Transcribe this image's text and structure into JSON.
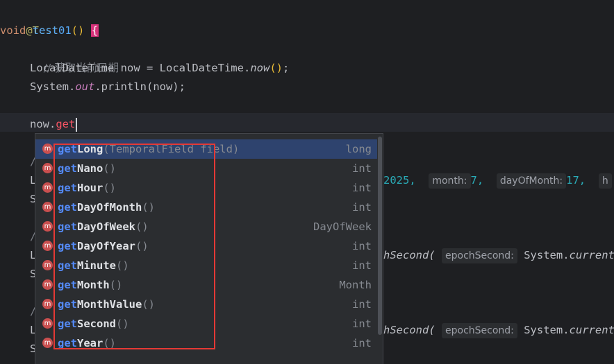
{
  "code": {
    "annotation": "@Test",
    "kw_void": "void",
    "method_name": "test01",
    "method_parens": "()",
    "open_brace": "{",
    "comment1": "// 获取当前日期",
    "l4_type": "LocalDateTime",
    "l4_var": " now = ",
    "l4_cls": "LocalDateTime.",
    "l4_call": "now",
    "l4_parens": "()",
    "l4_end": ";",
    "l5_sys": "System.",
    "l5_out": "out",
    "l5_rest": ".println(now);",
    "l7_prefix": "now.",
    "l7_typed": "get",
    "behind_year_val": "2025,",
    "hint_month": "month:",
    "month_val": "7,",
    "hint_day": "dayOfMonth:",
    "day_val": "17,",
    "hint_h": "h",
    "behind_epoch1": "hSecond(",
    "hint_epoch1": "epochSecond:",
    "sys_current1": "System.",
    "current1": "current",
    "behind_epoch2": "hSecond(",
    "hint_epoch2": "epochSecond:",
    "sys_current2": "System.",
    "current2": "current"
  },
  "completion": {
    "icon_letter": "m",
    "typed": "get",
    "items": [
      {
        "rest": "Long",
        "params": "(TemporalField field)",
        "type": "long"
      },
      {
        "rest": "Nano",
        "params": "()",
        "type": "int"
      },
      {
        "rest": "Hour",
        "params": "()",
        "type": "int"
      },
      {
        "rest": "DayOfMonth",
        "params": "()",
        "type": "int"
      },
      {
        "rest": "DayOfWeek",
        "params": "()",
        "type": "DayOfWeek"
      },
      {
        "rest": "DayOfYear",
        "params": "()",
        "type": "int"
      },
      {
        "rest": "Minute",
        "params": "()",
        "type": "int"
      },
      {
        "rest": "Month",
        "params": "()",
        "type": "Month"
      },
      {
        "rest": "MonthValue",
        "params": "()",
        "type": "int"
      },
      {
        "rest": "Second",
        "params": "()",
        "type": "int"
      },
      {
        "rest": "Year",
        "params": "()",
        "type": "int"
      }
    ]
  },
  "colors": {
    "background": "#1e1f22",
    "selection": "#2e436e",
    "highlight_box": "#e53935"
  }
}
